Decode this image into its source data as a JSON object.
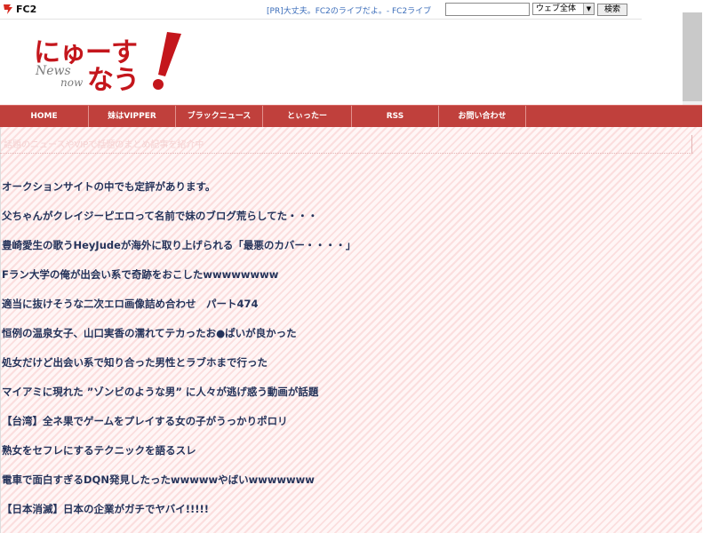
{
  "fc2": {
    "logo_text": "FC2",
    "pr_text": "[PR]大丈夫。FC2のライブだよ。- FC2ライブ",
    "search_value": "",
    "scope_selected": "ウェブ全体",
    "search_button": "検索"
  },
  "site": {
    "logo_line1": "にゅーす",
    "logo_line2": "なう",
    "logo_news": "News",
    "logo_now": "now"
  },
  "nav": {
    "items": [
      {
        "label": "HOME"
      },
      {
        "label": "妹はVIPPER"
      },
      {
        "label": "ブラックニュース"
      },
      {
        "label": "とぃったー"
      },
      {
        "label": "RSS"
      },
      {
        "label": "お問い合わせ"
      }
    ]
  },
  "banner": {
    "text": "話題のニュースやVIPで話題のまとめ記事を紹介中"
  },
  "articles": [
    "オークションサイトの中でも定評があります。",
    "父ちゃんがクレイジーピエロって名前で妹のブログ荒らしてた・・・",
    "豊崎愛生の歌うHeyJudeが海外に取り上げられる「最悪のカバー・・・・」",
    "Fラン大学の俺が出会い系で奇跡をおこしたwwwwwwww",
    "適当に抜けそうな二次エロ画像詰め合わせ　パート474",
    "恒例の温泉女子、山口実香の濡れてテカったお●ぱいが良かった",
    "処女だけど出会い系で知り合った男性とラブホまで行った",
    "マイアミに現れた ”ゾンビのような男” に人々が逃げ惑う動画が話題",
    "【台湾】全ネ果でゲームをプレイする女の子がうっかりポロリ",
    "熟女をセフレにするテクニックを語るスレ",
    "電車で面白すぎるDQN発見したったwwwwwやばいwwwwwww",
    "【日本消滅】日本の企業がガチでヤバイ!!!!!"
  ],
  "colors": {
    "nav_red": "#c0403c",
    "logo_red": "#c4161c",
    "link_navy": "#25335a"
  }
}
